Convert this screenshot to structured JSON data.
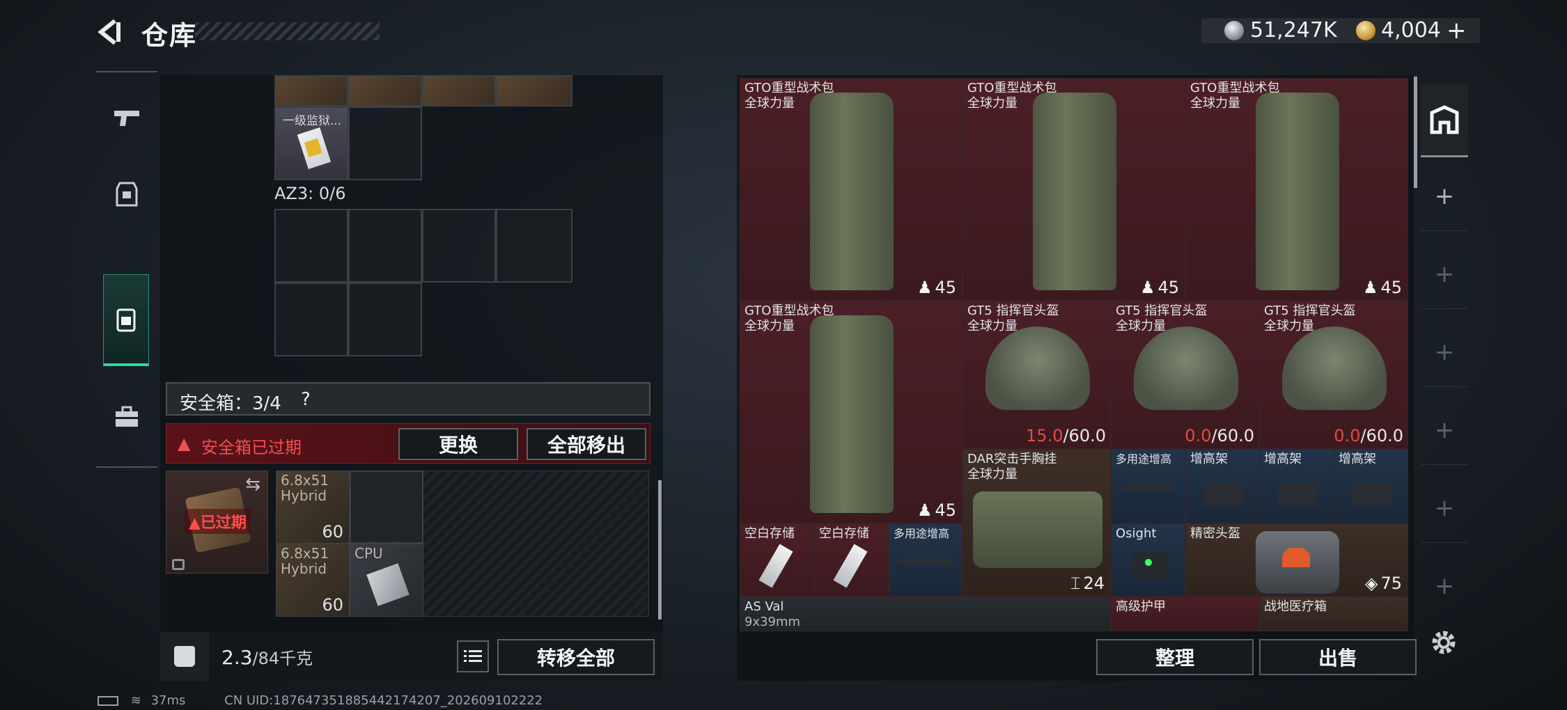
{
  "header": {
    "title": "仓库"
  },
  "currency": {
    "silver": "51,247K",
    "gold": "4,004"
  },
  "left": {
    "top_item_label": "一级监狱...",
    "az3_label": "AZ3: 0/6",
    "safe_box_label": "安全箱：3/4",
    "safe_help": "?",
    "warning": "安全箱已过期",
    "replace_btn": "更换",
    "remove_all_btn": "全部移出",
    "expired_label": "已过期",
    "ammo": [
      {
        "l1": "6.8x51",
        "l2": "Hybrid",
        "count": "60"
      },
      {
        "l1": "6.8x51",
        "l2": "Hybrid",
        "count": "60"
      },
      {
        "l1": "CPU",
        "l2": "",
        "count": ""
      }
    ],
    "weight": "2.3",
    "weight_max": "/84千克",
    "transfer_all_btn": "转移全部"
  },
  "right": {
    "backpacks": [
      {
        "name": "GTO重型战术包",
        "sub": "全球力量",
        "count": "45"
      },
      {
        "name": "GTO重型战术包",
        "sub": "全球力量",
        "count": "45"
      },
      {
        "name": "GTO重型战术包",
        "sub": "全球力量",
        "count": "45"
      },
      {
        "name": "GTO重型战术包",
        "sub": "全球力量",
        "count": "45"
      }
    ],
    "helmets": [
      {
        "name": "GT5 指挥官头盔",
        "sub": "全球力量",
        "cur": "15.0",
        "max": "/60.0"
      },
      {
        "name": "GT5 指挥官头盔",
        "sub": "全球力量",
        "cur": "0.0",
        "max": "/60.0"
      },
      {
        "name": "GT5 指挥官头盔",
        "sub": "全球力量",
        "cur": "0.0",
        "max": "/60.0"
      }
    ],
    "chest": {
      "name": "DAR突击手胸挂",
      "sub": "全球力量",
      "count": "24"
    },
    "small_items": [
      "多用途增高",
      "增高架",
      "增高架",
      "增高架"
    ],
    "storage": [
      "空白存储",
      "空白存储",
      "多用途增高"
    ],
    "osight": "Osight",
    "precision": {
      "name": "精密头盔",
      "count": "75"
    },
    "asval": {
      "name": "AS Val",
      "sub": "9x39mm"
    },
    "armor": "高级护甲",
    "medkit": "战地医疗箱",
    "sort_btn": "整理",
    "sell_btn": "出售"
  },
  "status": {
    "ping": "37ms",
    "uid": "CN UID:18764735188544217420​7_202609102222"
  }
}
